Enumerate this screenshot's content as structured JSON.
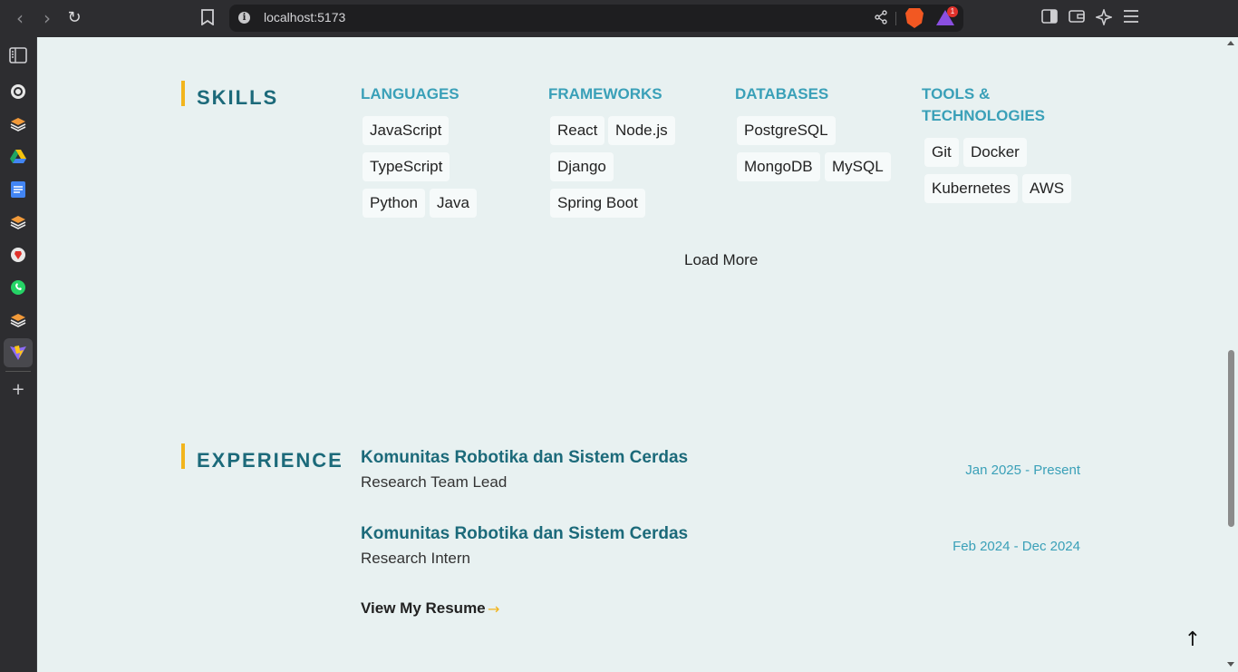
{
  "browser": {
    "url": "localhost:5173",
    "rewards_badge": "1"
  },
  "sidebar": {
    "icons": [
      "sidebar-panel-icon",
      "chatgpt-icon",
      "stack-icon",
      "google-drive-icon",
      "google-docs-icon",
      "stack-icon",
      "brave-icon",
      "whatsapp-icon",
      "stack-icon",
      "vite-icon"
    ],
    "add_label": "+"
  },
  "skills": {
    "title": "SKILLS",
    "categories": [
      {
        "title": "LANGUAGES",
        "tags": [
          "JavaScript",
          "TypeScript",
          "Python",
          "Java"
        ]
      },
      {
        "title": "FRAMEWORKS",
        "tags": [
          "React",
          "Node.js",
          "Django",
          "Spring Boot"
        ]
      },
      {
        "title": "DATABASES",
        "tags": [
          "PostgreSQL",
          "MongoDB",
          "MySQL"
        ]
      },
      {
        "title": "TOOLS &",
        "title2": "TECHNOLOGIES",
        "tags": [
          "Git",
          "Docker",
          "Kubernetes",
          "AWS"
        ]
      }
    ],
    "load_more": "Load More"
  },
  "experience": {
    "title": "EXPERIENCE",
    "items": [
      {
        "org": "Komunitas Robotika dan Sistem Cerdas",
        "role": "Research Team Lead",
        "date": "Jan 2025 - Present"
      },
      {
        "org": "Komunitas Robotika dan Sistem Cerdas",
        "role": "Research Intern",
        "date": "Feb 2024 - Dec 2024"
      }
    ],
    "resume_link": "View My Resume",
    "resume_arrow": "→"
  },
  "back_to_top": "↑",
  "colors": {
    "accent": "#f2b51d",
    "heading": "#1c6a7a",
    "category": "#3aa0b8",
    "background": "#e8f1f1"
  }
}
